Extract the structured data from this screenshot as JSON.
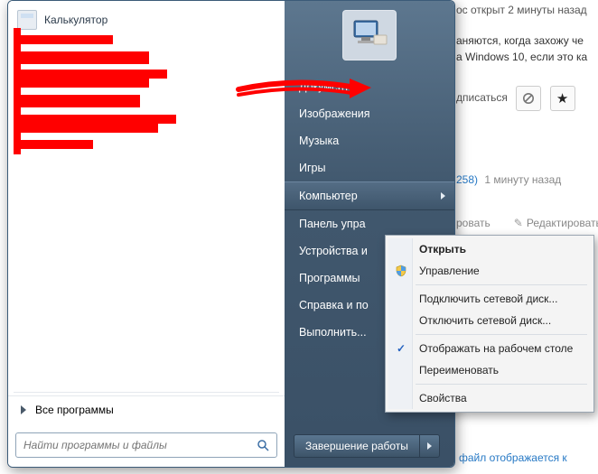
{
  "background": {
    "frag_time": "ос открыт 2 минуты назад",
    "frag_line1": "аняются, когда захожу че",
    "frag_line2": "а Windows 10, если это ка",
    "subscribe": "дписаться",
    "ans_count": "258)",
    "ans_time": "1 минуту назад",
    "edit_a": "ровать",
    "edit_b": "Редактировать",
    "bottom": "файл отображается к"
  },
  "start": {
    "program_calc": "Калькулятор",
    "all_programs": "Все программы",
    "search_placeholder": "Найти программы и файлы",
    "right": {
      "documents": "Документы",
      "pictures": "Изображения",
      "music": "Музыка",
      "games": "Игры",
      "computer": "Компьютер",
      "control_panel": "Панель упра",
      "devices": "Устройства и",
      "default_programs": "Программы",
      "help": "Справка и по",
      "run": "Выполнить..."
    },
    "shutdown": "Завершение работы"
  },
  "context_menu": {
    "open": "Открыть",
    "manage": "Управление",
    "map_drive": "Подключить сетевой диск...",
    "disconnect_drive": "Отключить сетевой диск...",
    "show_desktop": "Отображать на рабочем столе",
    "rename": "Переименовать",
    "properties": "Свойства"
  }
}
